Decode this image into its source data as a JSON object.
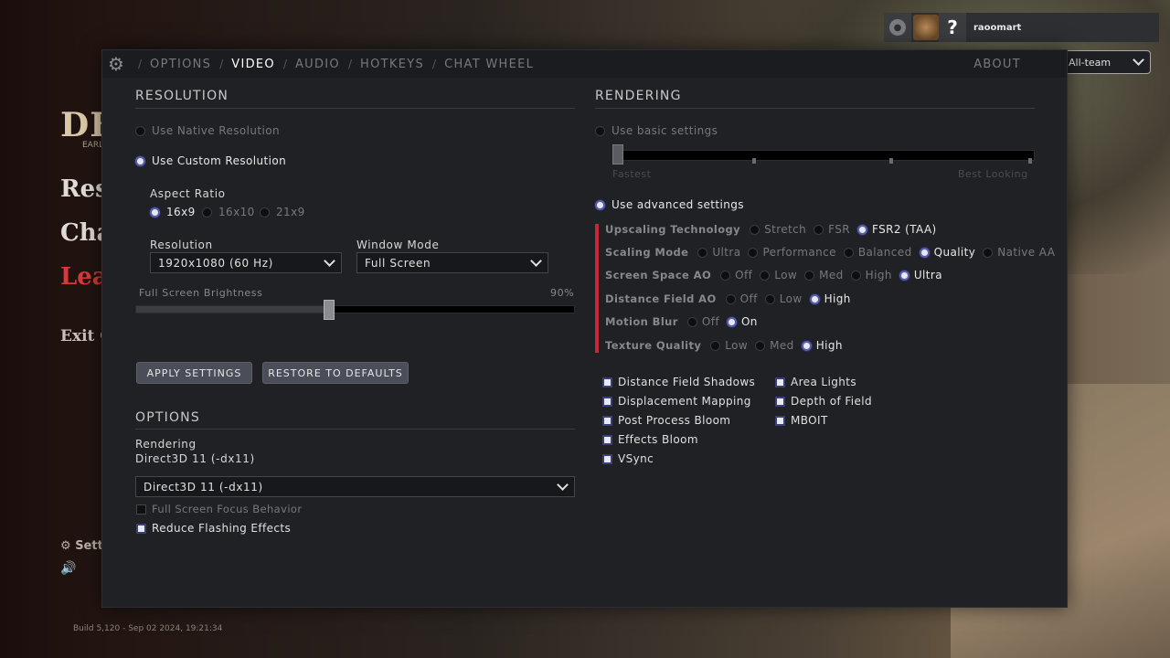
{
  "game_menu": {
    "logo": "DE",
    "logo_sub": "EARL",
    "items": [
      "Res",
      "Cha",
      "Leav",
      "Exit G"
    ],
    "settings_label": "Sett",
    "build": "Build 5,120 - Sep 02 2024, 19:21:34"
  },
  "user": {
    "name": "raoomart",
    "question_mark": "?",
    "team_select": "All-team"
  },
  "tabs": {
    "items": [
      "OPTIONS",
      "VIDEO",
      "AUDIO",
      "HOTKEYS",
      "CHAT WHEEL"
    ],
    "active": "VIDEO",
    "about": "ABOUT"
  },
  "resolution": {
    "title": "RESOLUTION",
    "native": "Use Native Resolution",
    "custom": "Use Custom Resolution",
    "aspect_label": "Aspect Ratio",
    "aspect_options": [
      "16x9",
      "16x10",
      "21x9"
    ],
    "aspect_selected": "16x9",
    "resolution_label": "Resolution",
    "resolution_value": "1920x1080 (60 Hz)",
    "window_mode_label": "Window Mode",
    "window_mode_value": "Full Screen",
    "brightness_label": "Full Screen Brightness",
    "brightness_value": "90%",
    "brightness_level": 0.44,
    "apply": "APPLY SETTINGS",
    "restore": "RESTORE TO DEFAULTS"
  },
  "options": {
    "title": "OPTIONS",
    "rendering_label": "Rendering",
    "rendering_current": "Direct3D 11 (-dx11)",
    "rendering_select": "Direct3D 11 (-dx11)",
    "focus_behavior": "Full Screen Focus Behavior",
    "focus_checked": false,
    "reduce_flashing": "Reduce Flashing Effects",
    "reduce_flashing_checked": true
  },
  "rendering": {
    "title": "RENDERING",
    "basic": "Use basic settings",
    "fastest": "Fastest",
    "best_looking": "Best Looking",
    "advanced": "Use advanced settings",
    "rows": [
      {
        "label": "Upscaling Technology",
        "options": [
          "Stretch",
          "FSR",
          "FSR2 (TAA)"
        ],
        "selected": 2
      },
      {
        "label": "Scaling Mode",
        "options": [
          "Ultra",
          "Performance",
          "Balanced",
          "Quality",
          "Native AA"
        ],
        "selected": 3
      },
      {
        "label": "Screen Space AO",
        "options": [
          "Off",
          "Low",
          "Med",
          "High",
          "Ultra"
        ],
        "selected": 4
      },
      {
        "label": "Distance Field AO",
        "options": [
          "Off",
          "Low",
          "High"
        ],
        "selected": 2
      },
      {
        "label": "Motion Blur",
        "options": [
          "Off",
          "On"
        ],
        "selected": 1
      },
      {
        "label": "Texture Quality",
        "options": [
          "Low",
          "Med",
          "High"
        ],
        "selected": 2
      }
    ],
    "checkboxes_left": [
      "Distance Field Shadows",
      "Displacement Mapping",
      "Post Process Bloom",
      "Effects Bloom",
      "VSync"
    ],
    "checkboxes_right": [
      "Area Lights",
      "Depth of Field",
      "MBOIT"
    ]
  }
}
